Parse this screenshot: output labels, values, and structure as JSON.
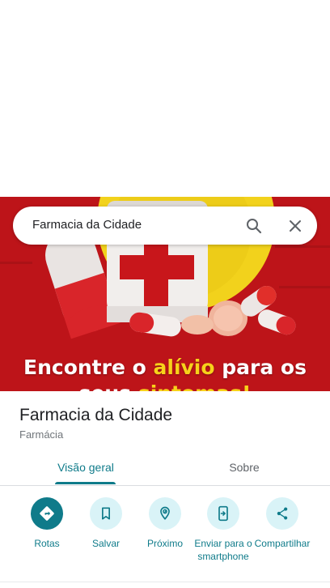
{
  "hero": {
    "line1_a": "Encontre o ",
    "line1_b": "alívio",
    "line1_c": " para os",
    "line2_a": "seus ",
    "line2_b": "sintomas!"
  },
  "search": {
    "query": "Farmacia da Cidade"
  },
  "place": {
    "name": "Farmacia da Cidade",
    "category": "Farmácia"
  },
  "tabs": [
    {
      "label": "Visão geral",
      "active": true
    },
    {
      "label": "Sobre",
      "active": false
    }
  ],
  "actions": [
    {
      "label": "Rotas",
      "icon": "directions-icon"
    },
    {
      "label": "Salvar",
      "icon": "bookmark-icon"
    },
    {
      "label": "Próximo",
      "icon": "nearby-icon"
    },
    {
      "label": "Enviar para o smartphone",
      "icon": "send-to-phone-icon"
    },
    {
      "label": "Compartilhar",
      "icon": "share-icon"
    }
  ],
  "colors": {
    "accent": "#0f7b8a",
    "accent_light": "#d9f3f7",
    "hero_red": "#c8161b",
    "hero_yellow": "#f7d21a"
  }
}
